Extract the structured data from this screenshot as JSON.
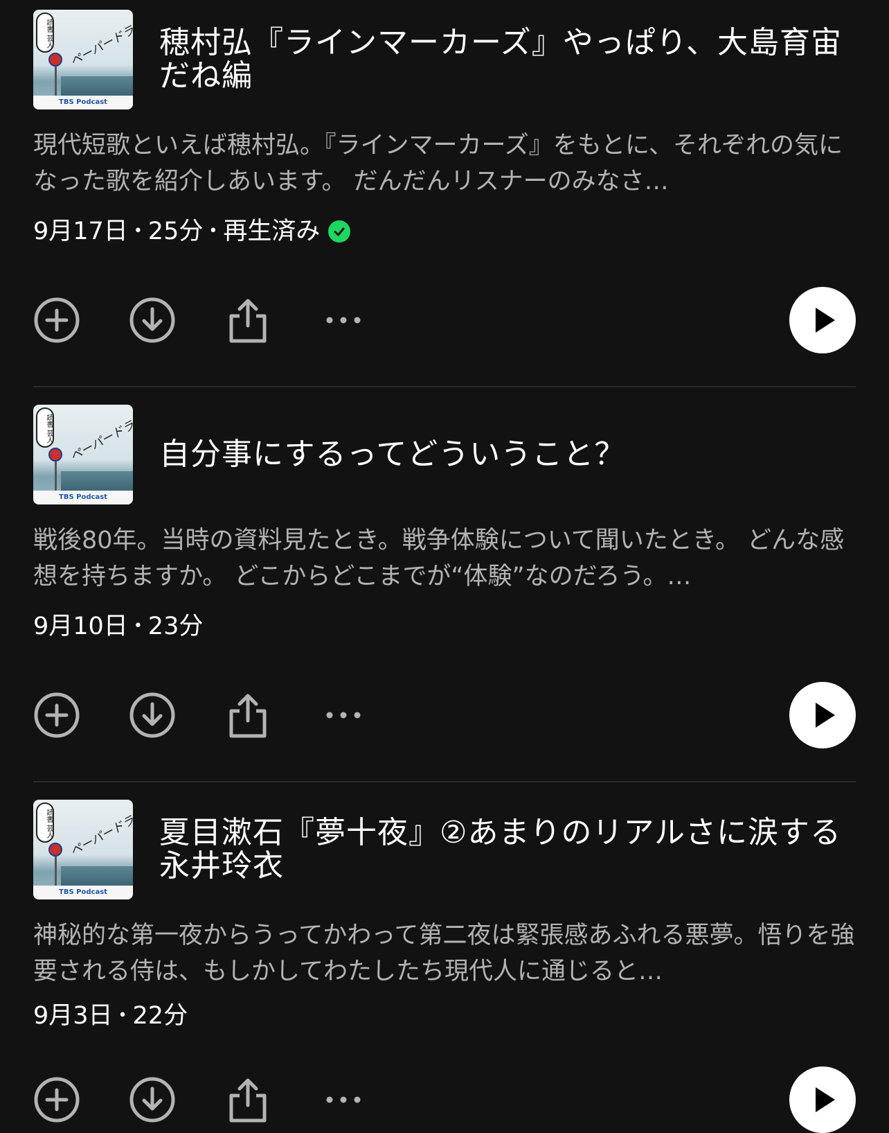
{
  "episodes": [
    {
      "cover_tag": "TBS Podcast",
      "cover_script": "ペーパードライブ",
      "cover_bubble": "読書 芸人",
      "title": "穂村弘『ラインマーカーズ』やっぱり、大島育宙だね編",
      "description": "現代短歌といえば穂村弘。『ラインマーカーズ』をもとに、それぞれの気になった歌を紹介しあいます。 だんだんリスナーのみなさ…",
      "date": "9月17日",
      "duration": "25分",
      "status": "再生済み",
      "played": true
    },
    {
      "cover_tag": "TBS Podcast",
      "cover_script": "ペーパードライブ",
      "cover_bubble": "読書 芸人",
      "title": "自分事にするってどういうこと？",
      "description": "戦後80年。当時の資料見たとき。戦争体験について聞いたとき。 どんな感想を持ちますか。 どこからどこまでが“体験”なのだろう。…",
      "date": "9月10日",
      "duration": "23分",
      "status": "",
      "played": false
    },
    {
      "cover_tag": "TBS Podcast",
      "cover_script": "ペーパードライブ",
      "cover_bubble": "読書 芸人",
      "title": "夏目漱石『夢十夜』②あまりのリアルさに涙する永井玲衣",
      "description": "神秘的な第一夜からうってかわって第二夜は緊張感あふれる悪夢。悟りを強要される侍は、もしかしてわたしたち現代人に通じると…",
      "date": "9月3日",
      "duration": "22分",
      "status": "",
      "played": false
    }
  ],
  "meta_separator": "•",
  "colors": {
    "background": "#121212",
    "played_check": "#1ed760",
    "secondary_text": "#b3b3b3"
  },
  "icons": [
    "add-circle-icon",
    "download-circle-icon",
    "share-icon",
    "more-dots-icon",
    "play-icon",
    "check-icon"
  ]
}
